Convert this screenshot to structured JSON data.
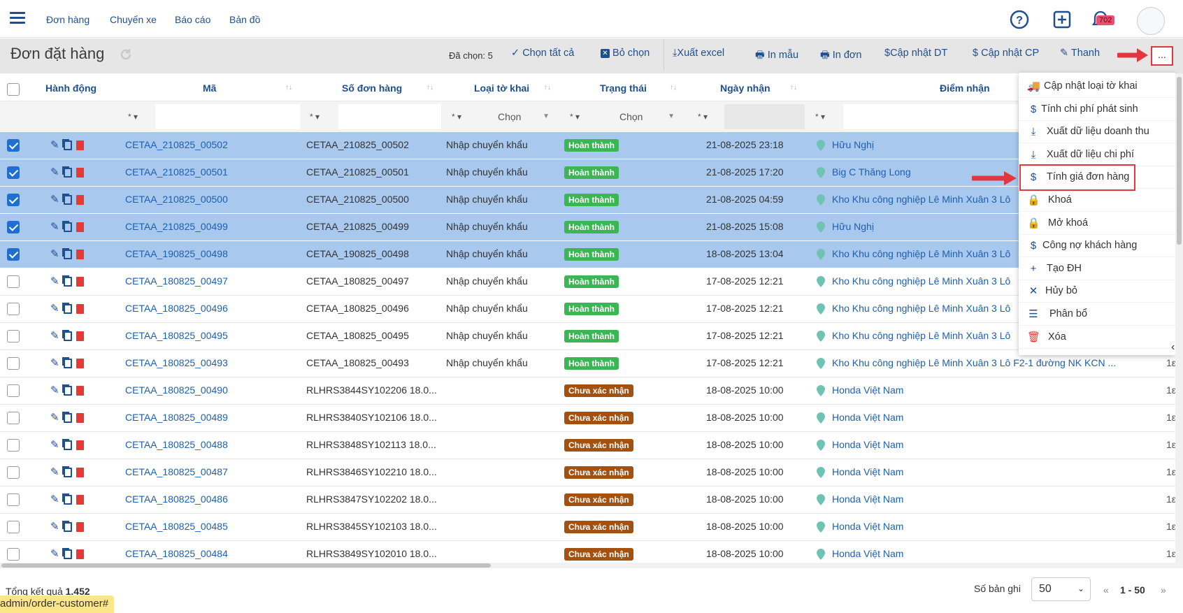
{
  "nav": {
    "links": [
      "Đơn hàng",
      "Chuyến xe",
      "Báo cáo",
      "Bản đồ"
    ],
    "notification_count": "702"
  },
  "toolbar": {
    "title": "Đơn đặt hàng",
    "selected_count": "Đã chọn: 5",
    "select_all": "Chọn tất cả",
    "deselect": "Bỏ chọn",
    "export_excel": "Xuất excel",
    "print_template": "In mẫu",
    "print_order": "In đơn",
    "update_revenue": "Cập nhật DT",
    "update_cost": "Cập nhật CP",
    "pay": "Thanh",
    "more": "..."
  },
  "table": {
    "headers": {
      "action": "Hành động",
      "code": "Mã",
      "order_no": "Số đơn hàng",
      "declaration_type": "Loại tờ khai",
      "status": "Trạng thái",
      "received_date": "Ngày nhận",
      "pickup_point": "Điểm nhận"
    },
    "filters": {
      "op": "*",
      "select_placeholder": "Chọn"
    },
    "rows": [
      {
        "selected": true,
        "code": "CETAA_210825_00502",
        "order_no": "CETAA_210825_00502",
        "type": "Nhập chuyển khẩu",
        "status": "Hoàn thành",
        "status_kind": "done",
        "date": "21-08-2025 23:18",
        "point": "Hữu Nghị"
      },
      {
        "selected": true,
        "code": "CETAA_210825_00501",
        "order_no": "CETAA_210825_00501",
        "type": "Nhập chuyển khẩu",
        "status": "Hoàn thành",
        "status_kind": "done",
        "date": "21-08-2025 17:20",
        "point": "Big C Thăng Long"
      },
      {
        "selected": true,
        "code": "CETAA_210825_00500",
        "order_no": "CETAA_210825_00500",
        "type": "Nhập chuyển khẩu",
        "status": "Hoàn thành",
        "status_kind": "done",
        "date": "21-08-2025 04:59",
        "point": "Kho Khu công nghiệp Lê Minh Xuân 3 Lô"
      },
      {
        "selected": true,
        "code": "CETAA_210825_00499",
        "order_no": "CETAA_210825_00499",
        "type": "Nhập chuyển khẩu",
        "status": "Hoàn thành",
        "status_kind": "done",
        "date": "21-08-2025 15:08",
        "point": "Hữu Nghị"
      },
      {
        "selected": true,
        "code": "CETAA_190825_00498",
        "order_no": "CETAA_190825_00498",
        "type": "Nhập chuyển khẩu",
        "status": "Hoàn thành",
        "status_kind": "done",
        "date": "18-08-2025 13:04",
        "point": "Kho Khu công nghiệp Lê Minh Xuân 3 Lô"
      },
      {
        "selected": false,
        "code": "CETAA_180825_00497",
        "order_no": "CETAA_180825_00497",
        "type": "Nhập chuyển khẩu",
        "status": "Hoàn thành",
        "status_kind": "done",
        "date": "17-08-2025 12:21",
        "point": "Kho Khu công nghiệp Lê Minh Xuân 3 Lô"
      },
      {
        "selected": false,
        "code": "CETAA_180825_00496",
        "order_no": "CETAA_180825_00496",
        "type": "Nhập chuyển khẩu",
        "status": "Hoàn thành",
        "status_kind": "done",
        "date": "17-08-2025 12:21",
        "point": "Kho Khu công nghiệp Lê Minh Xuân 3 Lô"
      },
      {
        "selected": false,
        "code": "CETAA_180825_00495",
        "order_no": "CETAA_180825_00495",
        "type": "Nhập chuyển khẩu",
        "status": "Hoàn thành",
        "status_kind": "done",
        "date": "17-08-2025 12:21",
        "point": "Kho Khu công nghiệp Lê Minh Xuân 3 Lô"
      },
      {
        "selected": false,
        "code": "CETAA_180825_00493",
        "order_no": "CETAA_180825_00493",
        "type": "Nhập chuyển khẩu",
        "status": "Hoàn thành",
        "status_kind": "done",
        "date": "17-08-2025 12:21",
        "point": "Kho Khu công nghiệp Lê Minh Xuân 3 Lô F2-1 đường NK KCN ..."
      },
      {
        "selected": false,
        "code": "CETAA_180825_00490",
        "order_no": "RLHRS3844SY102206 18.0...",
        "type": "",
        "status": "Chưa xác nhận",
        "status_kind": "pend",
        "date": "18-08-2025 10:00",
        "point": "Honda Việt Nam"
      },
      {
        "selected": false,
        "code": "CETAA_180825_00489",
        "order_no": "RLHRS3840SY102106 18.0...",
        "type": "",
        "status": "Chưa xác nhận",
        "status_kind": "pend",
        "date": "18-08-2025 10:00",
        "point": "Honda Việt Nam"
      },
      {
        "selected": false,
        "code": "CETAA_180825_00488",
        "order_no": "RLHRS3848SY102113 18.0...",
        "type": "",
        "status": "Chưa xác nhận",
        "status_kind": "pend",
        "date": "18-08-2025 10:00",
        "point": "Honda Việt Nam"
      },
      {
        "selected": false,
        "code": "CETAA_180825_00487",
        "order_no": "RLHRS3846SY102210 18.0...",
        "type": "",
        "status": "Chưa xác nhận",
        "status_kind": "pend",
        "date": "18-08-2025 10:00",
        "point": "Honda Việt Nam"
      },
      {
        "selected": false,
        "code": "CETAA_180825_00486",
        "order_no": "RLHRS3847SY102202 18.0...",
        "type": "",
        "status": "Chưa xác nhận",
        "status_kind": "pend",
        "date": "18-08-2025 10:00",
        "point": "Honda Việt Nam"
      },
      {
        "selected": false,
        "code": "CETAA_180825_00485",
        "order_no": "RLHRS3845SY102103 18.0...",
        "type": "",
        "status": "Chưa xác nhận",
        "status_kind": "pend",
        "date": "18-08-2025 10:00",
        "point": "Honda Việt Nam"
      },
      {
        "selected": false,
        "code": "CETAA_180825_00484",
        "order_no": "RLHRS3849SY102010 18.0...",
        "type": "",
        "status": "Chưa xác nhận",
        "status_kind": "pend",
        "date": "18-08-2025 10:00",
        "point": "Honda Việt Nam"
      }
    ]
  },
  "dropdown": {
    "items": [
      {
        "icon": "truck-icon",
        "label": "Cập nhật loại tờ khai"
      },
      {
        "icon": "dollar-icon",
        "label": "Tính chi phí phát sinh"
      },
      {
        "icon": "download-icon",
        "label": "Xuất dữ liệu doanh thu"
      },
      {
        "icon": "download-icon",
        "label": "Xuất dữ liệu chi phí"
      },
      {
        "icon": "dollar-icon",
        "label": "Tính giá đơn hàng"
      },
      {
        "icon": "lock-icon",
        "label": "Khoá"
      },
      {
        "icon": "unlock-icon",
        "label": "Mở khoá"
      },
      {
        "icon": "dollar-icon",
        "label": "Công nợ khách hàng"
      },
      {
        "icon": "plus-icon",
        "label": "Tạo ĐH"
      },
      {
        "icon": "close-icon",
        "label": "Hủy bỏ"
      },
      {
        "icon": "list-icon",
        "label": "Phân bổ"
      },
      {
        "icon": "trash-icon",
        "label": "Xóa"
      }
    ]
  },
  "footer": {
    "total_label": "Tổng kết quả",
    "total_value": "1.452",
    "page_size_label": "Số bản ghi",
    "page_size": "50",
    "prev": "«",
    "range": "1 - 50",
    "next": "»",
    "url": "admin/order-customer#"
  },
  "colors": {
    "accent": "#1e4f8f",
    "selected_row": "#a8c8ee",
    "done": "#3cb554",
    "pending": "#a4500f",
    "highlight": "#e0383e"
  }
}
